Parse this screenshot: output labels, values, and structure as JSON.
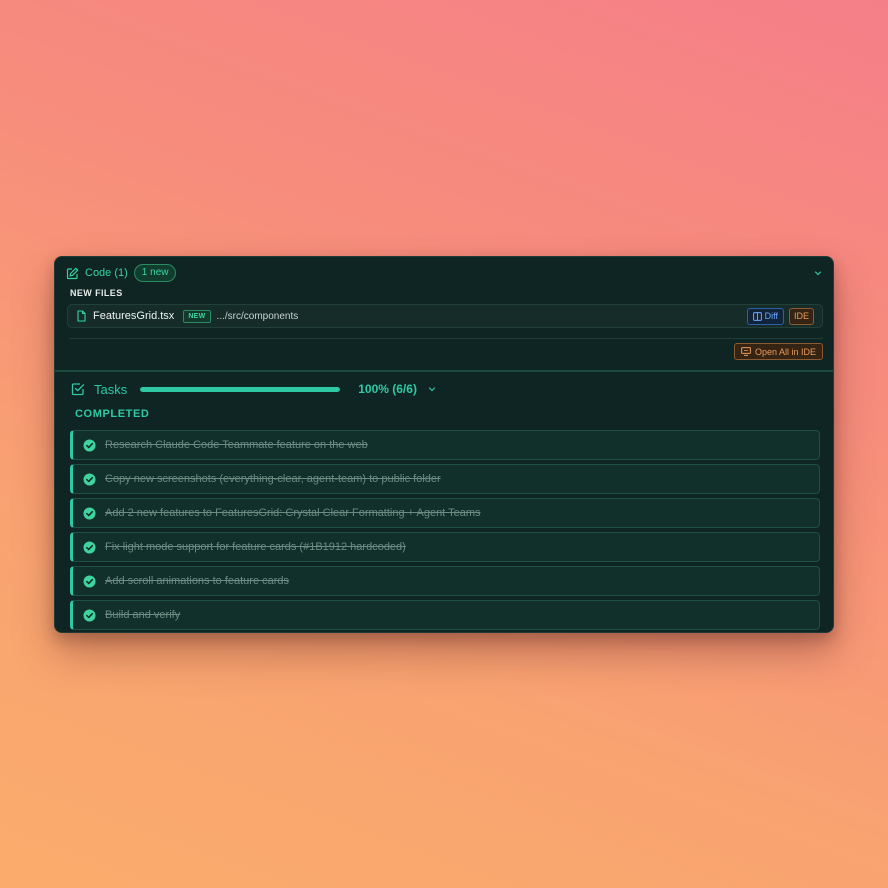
{
  "code": {
    "title": "Code (1)",
    "new_badge": "1 new",
    "new_files_label": "NEW FILES",
    "files": [
      {
        "name": "FeaturesGrid.tsx",
        "tag": "NEW",
        "path": ".../src/components",
        "diff_label": "Diff",
        "ide_label": "IDE"
      }
    ],
    "open_all_label": "Open All in IDE"
  },
  "tasks": {
    "title": "Tasks",
    "progress": 1.0,
    "progress_text": "100% (6/6)",
    "completed_label": "COMPLETED",
    "items": [
      {
        "label": "Research Claude Code Teammate feature on the web",
        "status": "completed"
      },
      {
        "label": "Copy new screenshots (everything-clear, agent-team) to public folder",
        "status": "completed"
      },
      {
        "label": "Add 2 new features to FeaturesGrid: Crystal Clear Formatting + Agent Teams",
        "status": "completed"
      },
      {
        "label": "Fix light mode support for feature cards (#1B1912 hardcoded)",
        "status": "completed"
      },
      {
        "label": "Add scroll animations to feature cards",
        "status": "completed"
      },
      {
        "label": "Build and verify",
        "status": "completed"
      }
    ]
  },
  "colors": {
    "accent": "#2ec9a4",
    "code_green": "#38d39f",
    "diff_blue": "#6ea6ff",
    "ide_orange": "#ec9a58",
    "panel_bg": "#0f2523"
  },
  "icons": {
    "code": "edit-icon",
    "file": "file-icon",
    "diff": "split-columns-icon",
    "open_all": "monitor-icon",
    "tasks": "checkbox-icon",
    "task_done": "check-circle-icon",
    "collapse": "chevron-down-icon"
  }
}
